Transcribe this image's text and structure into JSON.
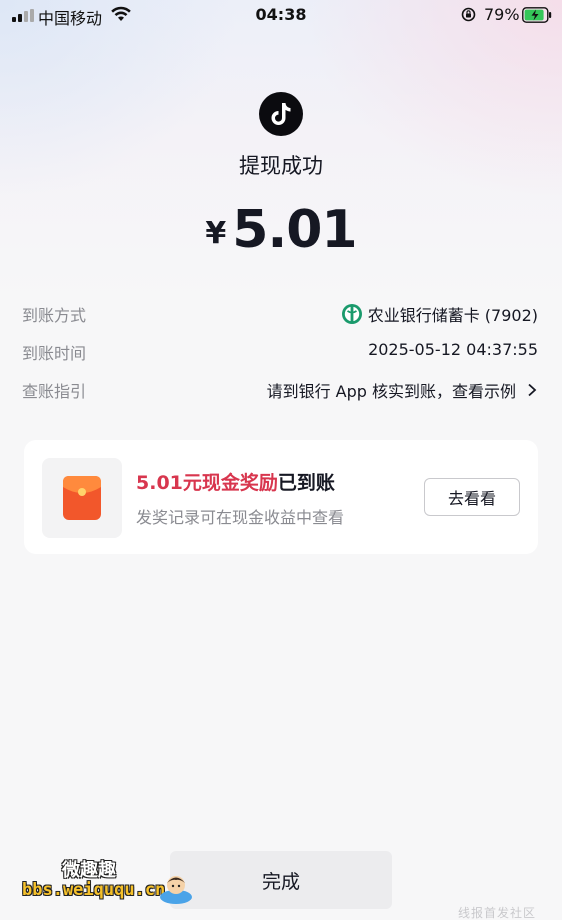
{
  "status_bar": {
    "carrier": "中国移动",
    "time": "04:38",
    "battery_percent": "79%",
    "icons": [
      "signal-icon",
      "wifi-icon",
      "rotation-lock-icon",
      "battery-charging-icon"
    ]
  },
  "header": {
    "app_icon": "tiktok-logo-icon",
    "title": "提现成功",
    "currency_symbol": "¥",
    "amount": "5.01"
  },
  "details": [
    {
      "label": "到账方式",
      "value": "农业银行储蓄卡 (7902)",
      "icon": "abc-bank-icon"
    },
    {
      "label": "到账时间",
      "value": "2025-05-12 04:37:55"
    },
    {
      "label": "查账指引",
      "value": "请到银行 App 核实到账，查看示例",
      "icon": "chevron-right-icon"
    }
  ],
  "reward_card": {
    "icon": "red-envelope-icon",
    "title_highlight": "5.01元现金奖励",
    "title_rest": "已到账",
    "subtitle": "发奖记录可在现金收益中查看",
    "button_label": "去看看"
  },
  "footer": {
    "done_label": "完成"
  },
  "watermark": {
    "logo_cn": "微趣趣",
    "logo_url": "bbs.weiququ.cn",
    "corner_text": "线报首发社区"
  },
  "colors": {
    "highlight_red": "#d8364e",
    "bank_green": "#1a9a6c",
    "envelope_orange": "#f2572b"
  }
}
